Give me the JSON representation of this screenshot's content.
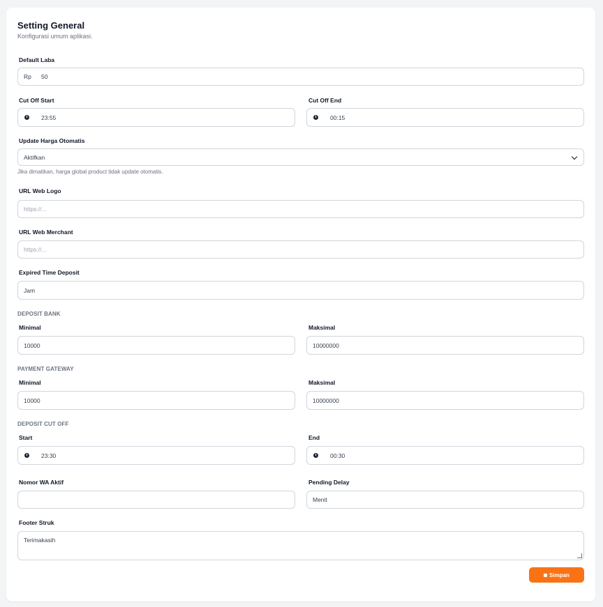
{
  "header": {
    "title": "Setting General",
    "subtitle": "Konfigurasi umum aplikasi."
  },
  "default_laba": {
    "label": "Default Laba",
    "prefix": "Rp",
    "value": "50"
  },
  "cut_off_start": {
    "label": "Cut Off Start",
    "value": "23:55",
    "icon": "clock-icon"
  },
  "cut_off_end": {
    "label": "Cut Off End",
    "value": "00:15",
    "icon": "clock-icon"
  },
  "update_harga": {
    "label": "Update Harga Otomatis",
    "value": "Aktifkan",
    "hint": "Jika dimatikan, harga global product tidak update otomatis.",
    "icon": "chevron-down-icon"
  },
  "url_logo": {
    "label": "URL Web Logo",
    "placeholder": "https://..."
  },
  "url_merchant": {
    "label": "URL Web Merchant",
    "placeholder": "https://..."
  },
  "expired_deposit": {
    "label": "Expired Time Deposit",
    "value": "Jam"
  },
  "deposit_bank": {
    "section": "DEPOSIT BANK",
    "min_label": "Minimal",
    "min_value": "10000",
    "max_label": "Maksimal",
    "max_value": "10000000"
  },
  "payment_gateway": {
    "section": "PAYMENT GATEWAY",
    "min_label": "Minimal",
    "min_value": "10000",
    "max_label": "Maksimal",
    "max_value": "10000000"
  },
  "deposit_cutoff": {
    "section": "DEPOSIT CUT OFF",
    "start_label": "Start",
    "start_value": "23:30",
    "end_label": "End",
    "end_value": "00:30"
  },
  "nomor_wa": {
    "label": "Nomor WA Aktif",
    "value": ""
  },
  "pending_delay": {
    "label": "Pending Delay",
    "value": "Menit"
  },
  "footer_struk": {
    "label": "Footer Struk",
    "value": "Terimakasih"
  },
  "save_button": {
    "label": "Simpan",
    "icon": "save-icon",
    "color": "#f97316"
  }
}
